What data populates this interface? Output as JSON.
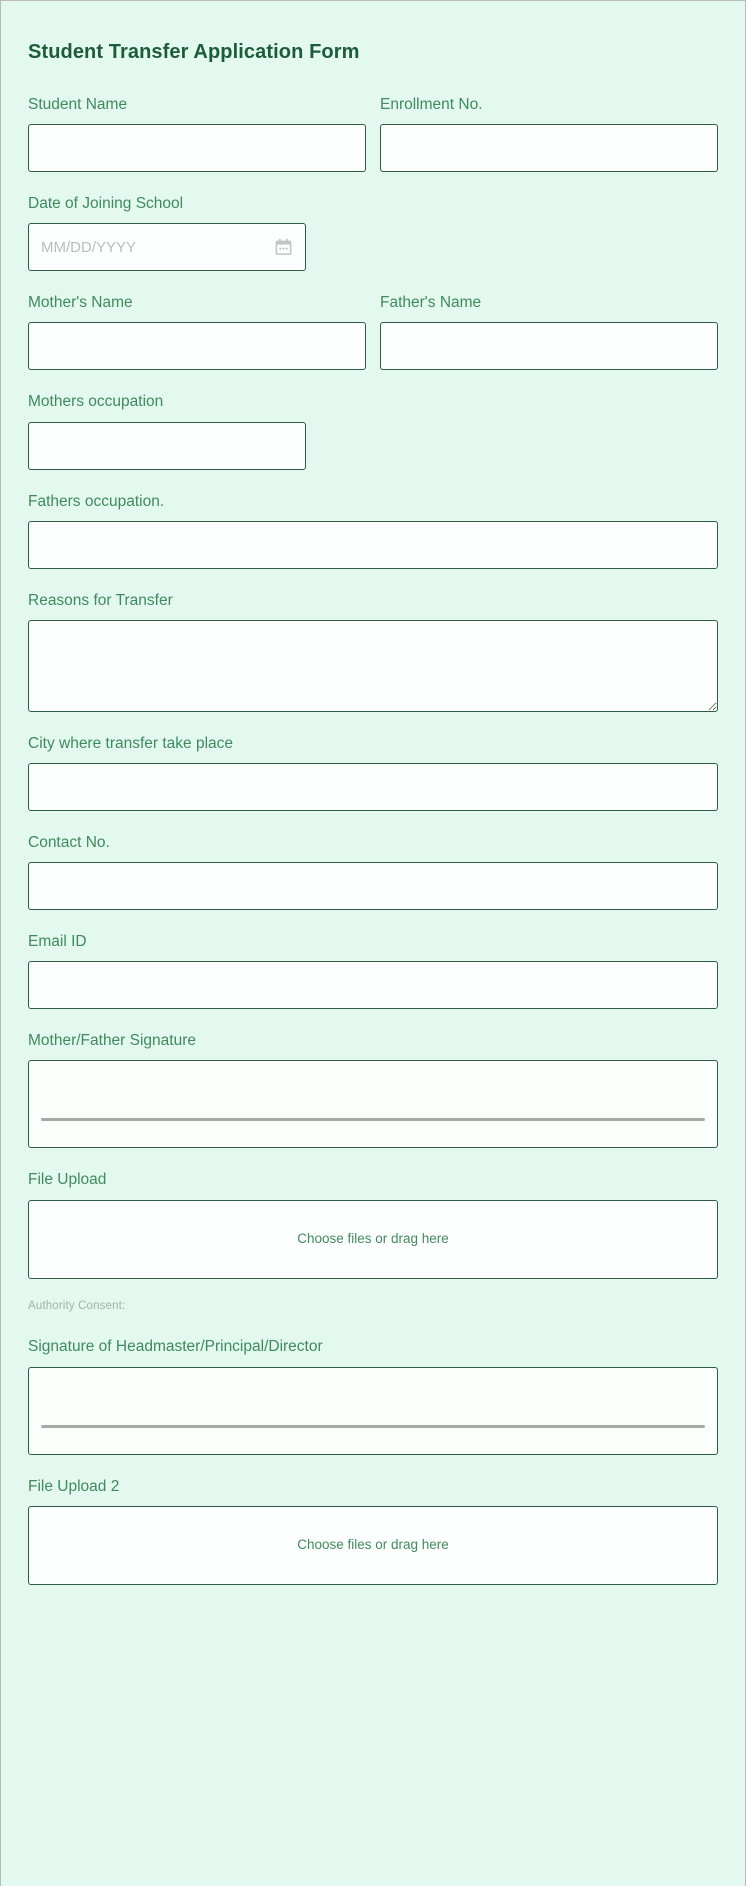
{
  "form": {
    "title": "Student Transfer Application Form",
    "consent_caption": "Authority Consent:",
    "fields": {
      "student_name": {
        "label": "Student Name",
        "value": "",
        "placeholder": ""
      },
      "enrollment_no": {
        "label": "Enrollment No.",
        "value": "",
        "placeholder": ""
      },
      "date_of_joining": {
        "label": "Date of Joining School",
        "value": "",
        "placeholder": "MM/DD/YYYY",
        "icon": "calendar-icon"
      },
      "mothers_name": {
        "label": "Mother's Name",
        "value": "",
        "placeholder": ""
      },
      "fathers_name": {
        "label": "Father's Name",
        "value": "",
        "placeholder": ""
      },
      "mothers_occupation": {
        "label": "Mothers occupation",
        "value": "",
        "placeholder": ""
      },
      "fathers_occupation": {
        "label": "Fathers occupation.",
        "value": "",
        "placeholder": ""
      },
      "reasons_for_transfer": {
        "label": "Reasons for Transfer",
        "value": "",
        "placeholder": ""
      },
      "city_of_transfer": {
        "label": "City where transfer take place",
        "value": "",
        "placeholder": ""
      },
      "contact_no": {
        "label": "Contact No.",
        "value": "",
        "placeholder": ""
      },
      "email_id": {
        "label": "Email ID",
        "value": "",
        "placeholder": ""
      },
      "parent_signature": {
        "label": "Mother/Father Signature",
        "value": ""
      },
      "file_upload_1": {
        "label": "File Upload",
        "dropzone_text": "Choose files or drag here"
      },
      "headmaster_signature": {
        "label": "Signature of Headmaster/Principal/Director",
        "value": ""
      },
      "file_upload_2": {
        "label": "File Upload 2",
        "dropzone_text": "Choose files or drag here"
      }
    }
  },
  "colors": {
    "page_background": "#e3f8ef",
    "title_text": "#1d5c3b",
    "label_text": "#3f8a5f",
    "input_border": "#2d5c42",
    "input_background": "#fdfffe",
    "placeholder_text": "#b9bcbd",
    "caption_text": "#9fb3a8",
    "signature_line": "#a8a8a8"
  }
}
